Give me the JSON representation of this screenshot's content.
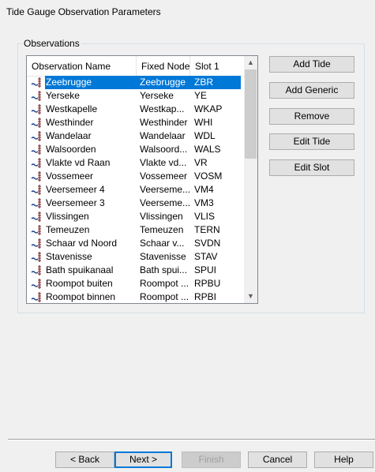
{
  "window": {
    "title": "Tide Gauge Observation Parameters"
  },
  "group": {
    "label": "Observations"
  },
  "list": {
    "columns": [
      "Observation Name",
      "Fixed Node",
      "Slot 1"
    ],
    "rows": [
      {
        "name": "Zeebrugge",
        "node": "Zeebrugge",
        "slot": "ZBR",
        "selected": true
      },
      {
        "name": "Yerseke",
        "node": "Yerseke",
        "slot": "YE"
      },
      {
        "name": "Westkapelle",
        "node": "Westkap...",
        "slot": "WKAP"
      },
      {
        "name": "Westhinder",
        "node": "Westhinder",
        "slot": "WHI"
      },
      {
        "name": "Wandelaar",
        "node": "Wandelaar",
        "slot": "WDL"
      },
      {
        "name": "Walsoorden",
        "node": "Walsoord...",
        "slot": "WALS"
      },
      {
        "name": "Vlakte vd Raan",
        "node": "Vlakte vd...",
        "slot": "VR"
      },
      {
        "name": "Vossemeer",
        "node": "Vossemeer",
        "slot": "VOSM"
      },
      {
        "name": "Veersemeer 4",
        "node": "Veerseme...",
        "slot": "VM4"
      },
      {
        "name": "Veersemeer 3",
        "node": "Veerseme...",
        "slot": "VM3"
      },
      {
        "name": "Vlissingen",
        "node": "Vlissingen",
        "slot": "VLIS"
      },
      {
        "name": "Temeuzen",
        "node": "Temeuzen",
        "slot": "TERN"
      },
      {
        "name": "Schaar vd Noord",
        "node": "Schaar v...",
        "slot": "SVDN"
      },
      {
        "name": "Stavenisse",
        "node": "Stavenisse",
        "slot": "STAV"
      },
      {
        "name": "Bath spuikanaal",
        "node": "Bath spui...",
        "slot": "SPUI"
      },
      {
        "name": "Roompot buiten",
        "node": "Roompot ...",
        "slot": "RPBU"
      },
      {
        "name": "Roompot binnen",
        "node": "Roompot ...",
        "slot": "RPBI"
      }
    ],
    "row_icon": "tide-gauge-icon"
  },
  "side_buttons": {
    "add_tide": "Add Tide",
    "add_generic": "Add Generic",
    "remove": "Remove",
    "edit_tide": "Edit Tide",
    "edit_slot": "Edit Slot"
  },
  "footer_buttons": {
    "back": "< Back",
    "next": "Next >",
    "finish": "Finish",
    "cancel": "Cancel",
    "help": "Help"
  },
  "colors": {
    "selection": "#0078d7",
    "background": "#f0f0f0"
  }
}
